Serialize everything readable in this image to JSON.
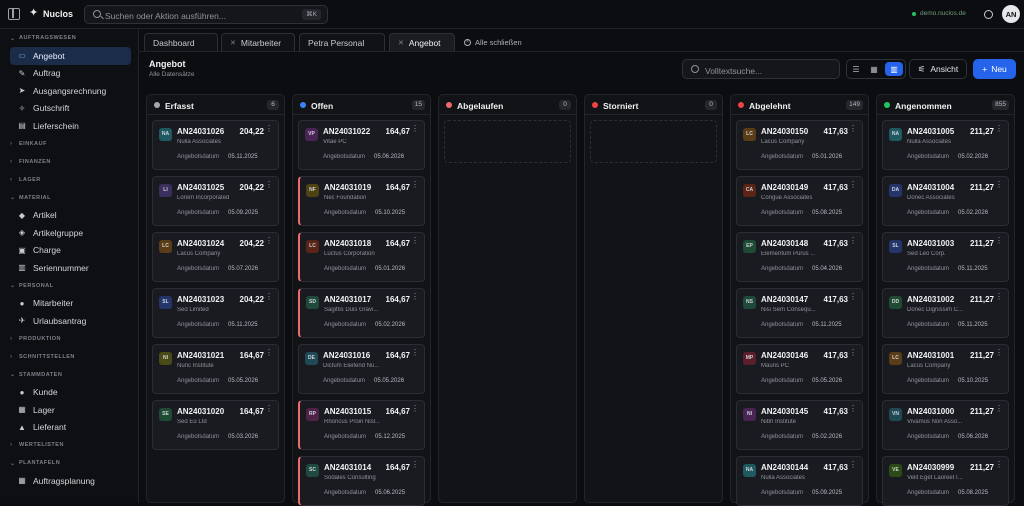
{
  "app": {
    "brand": "Nuclos",
    "env": "demo.nuclos.de",
    "user_initials": "AN"
  },
  "search": {
    "placeholder": "Suchen oder Aktion ausführen...",
    "shortcut": "⌘K"
  },
  "sidebar": {
    "sections": [
      {
        "label": "AUFTRAGSWESEN",
        "expanded": true,
        "items": [
          {
            "label": "Angebot",
            "icon": "chat-icon",
            "active": true
          },
          {
            "label": "Auftrag",
            "icon": "edit-icon"
          },
          {
            "label": "Ausgangsrechnung",
            "icon": "send-icon"
          },
          {
            "label": "Gutschrift",
            "icon": "receipt-icon"
          },
          {
            "label": "Lieferschein",
            "icon": "document-icon"
          }
        ]
      },
      {
        "label": "EINKAUF",
        "expanded": false,
        "items": []
      },
      {
        "label": "FINANZEN",
        "expanded": false,
        "items": []
      },
      {
        "label": "LAGER",
        "expanded": false,
        "items": []
      },
      {
        "label": "MATERIAL",
        "expanded": true,
        "items": [
          {
            "label": "Artikel",
            "icon": "tag-icon"
          },
          {
            "label": "Artikelgruppe",
            "icon": "tags-icon"
          },
          {
            "label": "Charge",
            "icon": "box-icon"
          },
          {
            "label": "Seriennummer",
            "icon": "barcode-icon"
          }
        ]
      },
      {
        "label": "PERSONAL",
        "expanded": true,
        "items": [
          {
            "label": "Mitarbeiter",
            "icon": "users-icon"
          },
          {
            "label": "Urlaubsantrag",
            "icon": "plane-icon"
          }
        ]
      },
      {
        "label": "PRODUKTION",
        "expanded": false,
        "items": []
      },
      {
        "label": "SCHNITTSTELLEN",
        "expanded": false,
        "items": []
      },
      {
        "label": "STAMMDATEN",
        "expanded": true,
        "items": [
          {
            "label": "Kunde",
            "icon": "user-icon"
          },
          {
            "label": "Lager",
            "icon": "warehouse-icon"
          },
          {
            "label": "Lieferant",
            "icon": "supplier-icon"
          }
        ]
      },
      {
        "label": "WERTELISTEN",
        "expanded": false,
        "items": []
      },
      {
        "label": "PLANTAFELN",
        "expanded": true,
        "items": [
          {
            "label": "Auftragsplanung",
            "icon": "calendar-icon"
          }
        ]
      }
    ]
  },
  "tabs": [
    {
      "label": "Dashboard",
      "close": false,
      "active": false
    },
    {
      "label": "Mitarbeiter",
      "close": true,
      "active": false
    },
    {
      "label": "Petra Personal",
      "close": false,
      "active": false
    },
    {
      "label": "Angebot",
      "close": true,
      "active": true
    }
  ],
  "close_all_label": "Alle schließen",
  "page": {
    "title": "Angebot",
    "subtitle": "Alle Datensätze",
    "fulltext_placeholder": "Volltextsuche...",
    "view_label": "Ansicht",
    "new_label": "Neu"
  },
  "colors": {
    "accent": "#2563eb",
    "warn": "#f06a6a"
  },
  "columns": [
    {
      "name": "Erfasst",
      "count": "6",
      "dot": "#a3a8b0",
      "cards": [
        {
          "badge": "NA",
          "bc": "#1f5a63",
          "no": "AN24031026",
          "amt": "204,22",
          "co": "Nulla Associates",
          "date": "05.11.2025"
        },
        {
          "badge": "LI",
          "bc": "#3b2f5e",
          "no": "AN24031025",
          "amt": "204,22",
          "co": "Lorem Incorporated",
          "date": "05.09.2025"
        },
        {
          "badge": "LC",
          "bc": "#5a3d17",
          "no": "AN24031024",
          "amt": "204,22",
          "co": "Lacus Company",
          "date": "05.07.2026"
        },
        {
          "badge": "SL",
          "bc": "#23356a",
          "no": "AN24031023",
          "amt": "204,22",
          "co": "Sed Limited",
          "date": "05.11.2025"
        },
        {
          "badge": "NI",
          "bc": "#4a4a17",
          "no": "AN24031021",
          "amt": "164,67",
          "co": "Nunc Institute",
          "date": "05.05.2026"
        },
        {
          "badge": "SE",
          "bc": "#1f4a33",
          "no": "AN24031020",
          "amt": "164,67",
          "co": "Sed Eu Ltd",
          "date": "05.03.2026"
        }
      ]
    },
    {
      "name": "Offen",
      "count": "15",
      "dot": "#3b82f6",
      "cards": [
        {
          "badge": "VP",
          "bc": "#4b2456",
          "no": "AN24031022",
          "amt": "164,67",
          "co": "Vitae PC",
          "date": "05.06.2026",
          "warn": false
        },
        {
          "badge": "NF",
          "bc": "#4e4214",
          "no": "AN24031019",
          "amt": "164,67",
          "co": "Nec Foundation",
          "date": "05.10.2025",
          "warn": true
        },
        {
          "badge": "LC",
          "bc": "#5a2417",
          "no": "AN24031018",
          "amt": "164,67",
          "co": "Luctus Corporation",
          "date": "05.01.2026",
          "warn": true
        },
        {
          "badge": "SD",
          "bc": "#1f4a3b",
          "no": "AN24031017",
          "amt": "164,67",
          "co": "Sagittis Duis Gravi...",
          "date": "05.02.2026",
          "warn": true
        },
        {
          "badge": "DE",
          "bc": "#1f4a55",
          "no": "AN24031016",
          "amt": "164,67",
          "co": "Dictum Eleifend Nu...",
          "date": "05.05.2026",
          "warn": false
        },
        {
          "badge": "RP",
          "bc": "#4e2347",
          "no": "AN24031015",
          "amt": "164,67",
          "co": "Rhoncus Proin Nisl...",
          "date": "05.12.2025",
          "warn": true
        },
        {
          "badge": "SC",
          "bc": "#1f4a40",
          "no": "AN24031014",
          "amt": "164,67",
          "co": "Sodales Consulting",
          "date": "05.06.2025",
          "warn": true
        }
      ]
    },
    {
      "name": "Abgelaufen",
      "count": "0",
      "dot": "#f06a6a",
      "cards": []
    },
    {
      "name": "Storniert",
      "count": "0",
      "dot": "#ef4444",
      "cards": []
    },
    {
      "name": "Abgelehnt",
      "count": "149",
      "dot": "#ef4444",
      "cards": [
        {
          "badge": "LC",
          "bc": "#5a3d17",
          "no": "AN24030150",
          "amt": "417,63",
          "co": "Lacus Company",
          "date": "05.01.2026"
        },
        {
          "badge": "CA",
          "bc": "#5a2417",
          "no": "AN24030149",
          "amt": "417,63",
          "co": "Congue Associates",
          "date": "05.08.2025"
        },
        {
          "badge": "EP",
          "bc": "#1f4a33",
          "no": "AN24030148",
          "amt": "417,63",
          "co": "Elementum Purus ...",
          "date": "05.04.2026"
        },
        {
          "badge": "NS",
          "bc": "#1f4a3b",
          "no": "AN24030147",
          "amt": "417,63",
          "co": "Nisi Sem Consequ...",
          "date": "05.11.2025"
        },
        {
          "badge": "MP",
          "bc": "#5a1f2a",
          "no": "AN24030146",
          "amt": "417,63",
          "co": "Mauris PC",
          "date": "05.05.2026"
        },
        {
          "badge": "NI",
          "bc": "#4b2456",
          "no": "AN24030145",
          "amt": "417,63",
          "co": "Nibh Institute",
          "date": "05.02.2026"
        },
        {
          "badge": "NA",
          "bc": "#1f5a63",
          "no": "AN24030144",
          "amt": "417,63",
          "co": "Nulla Associates",
          "date": "05.09.2025"
        }
      ]
    },
    {
      "name": "Angenommen",
      "count": "855",
      "dot": "#22c55e",
      "cards": [
        {
          "badge": "NA",
          "bc": "#1f5a63",
          "no": "AN24031005",
          "amt": "211,27",
          "co": "Nulla Associates",
          "date": "05.02.2026"
        },
        {
          "badge": "DA",
          "bc": "#23356a",
          "no": "AN24031004",
          "amt": "211,27",
          "co": "Donec Associates",
          "date": "05.02.2026"
        },
        {
          "badge": "SL",
          "bc": "#23356a",
          "no": "AN24031003",
          "amt": "211,27",
          "co": "Sed Leo Corp.",
          "date": "05.11.2025"
        },
        {
          "badge": "DD",
          "bc": "#1f4a33",
          "no": "AN24031002",
          "amt": "211,27",
          "co": "Donec Dignissim C...",
          "date": "05.11.2025"
        },
        {
          "badge": "LC",
          "bc": "#5a3d17",
          "no": "AN24031001",
          "amt": "211,27",
          "co": "Lacus Company",
          "date": "05.10.2025"
        },
        {
          "badge": "VN",
          "bc": "#1f4a55",
          "no": "AN24031000",
          "amt": "211,27",
          "co": "Vivamus Non Asso...",
          "date": "05.06.2026"
        },
        {
          "badge": "VE",
          "bc": "#2a4a17",
          "no": "AN24030999",
          "amt": "211,27",
          "co": "Velit Eget Laoreet I...",
          "date": "05.08.2025"
        }
      ]
    }
  ],
  "card_date_label": "Angebotsdatum"
}
